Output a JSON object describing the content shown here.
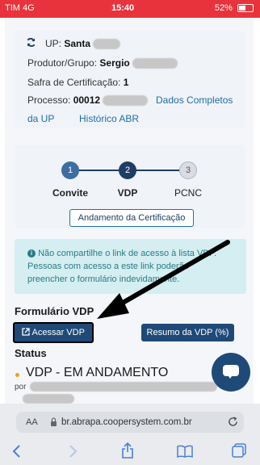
{
  "status_bar": {
    "carrier": "TIM 4G",
    "time": "15:40",
    "battery": "52%"
  },
  "info": {
    "up_label": "UP:",
    "up_value": "Santa",
    "produtor_label": "Produtor/Grupo:",
    "produtor_value": "Sergio",
    "safra_label": "Safra de Certificação:",
    "safra_value": "1",
    "processo_label": "Processo:",
    "processo_value": "00012",
    "link_dados": "Dados Completos",
    "link_dados_2": "da UP",
    "link_historico": "Histórico ABR"
  },
  "steps": [
    {
      "number": "1",
      "label": "Convite"
    },
    {
      "number": "2",
      "label": "VDP"
    },
    {
      "number": "3",
      "label": "PCNC"
    }
  ],
  "andamento_button": "Andamento da Certificação",
  "alert": {
    "line1": "Não compartilhe o link de acesso à lista VDP.",
    "line2": "Pessoas com acesso a este link poderão",
    "line3": "preencher o formulário indevidamente."
  },
  "formulario": {
    "title": "Formulário VDP",
    "acessar_button": "Acessar VDP",
    "resumo_button": "Resumo da VDP (%)"
  },
  "status": {
    "title": "Status",
    "value": "VDP - EM ANDAMENTO",
    "por": "por"
  },
  "browser": {
    "text_size": "AA",
    "url": "br.abrapa.coopersystem.com.br"
  },
  "icons": {
    "refresh": "refresh-icon",
    "info": "info-icon",
    "external_link": "external-link-icon",
    "chat": "chat-icon",
    "lock": "lock-icon",
    "reload": "reload-icon",
    "back": "back-icon",
    "forward": "forward-icon",
    "share": "share-icon",
    "bookmarks": "bookmarks-icon",
    "tabs": "tabs-icon"
  },
  "colors": {
    "status_bar": "#e8333c",
    "primary": "#1f4a78",
    "link": "#1f6fa8",
    "alert_bg": "#d4eef1",
    "status_dot": "#f0a020"
  }
}
